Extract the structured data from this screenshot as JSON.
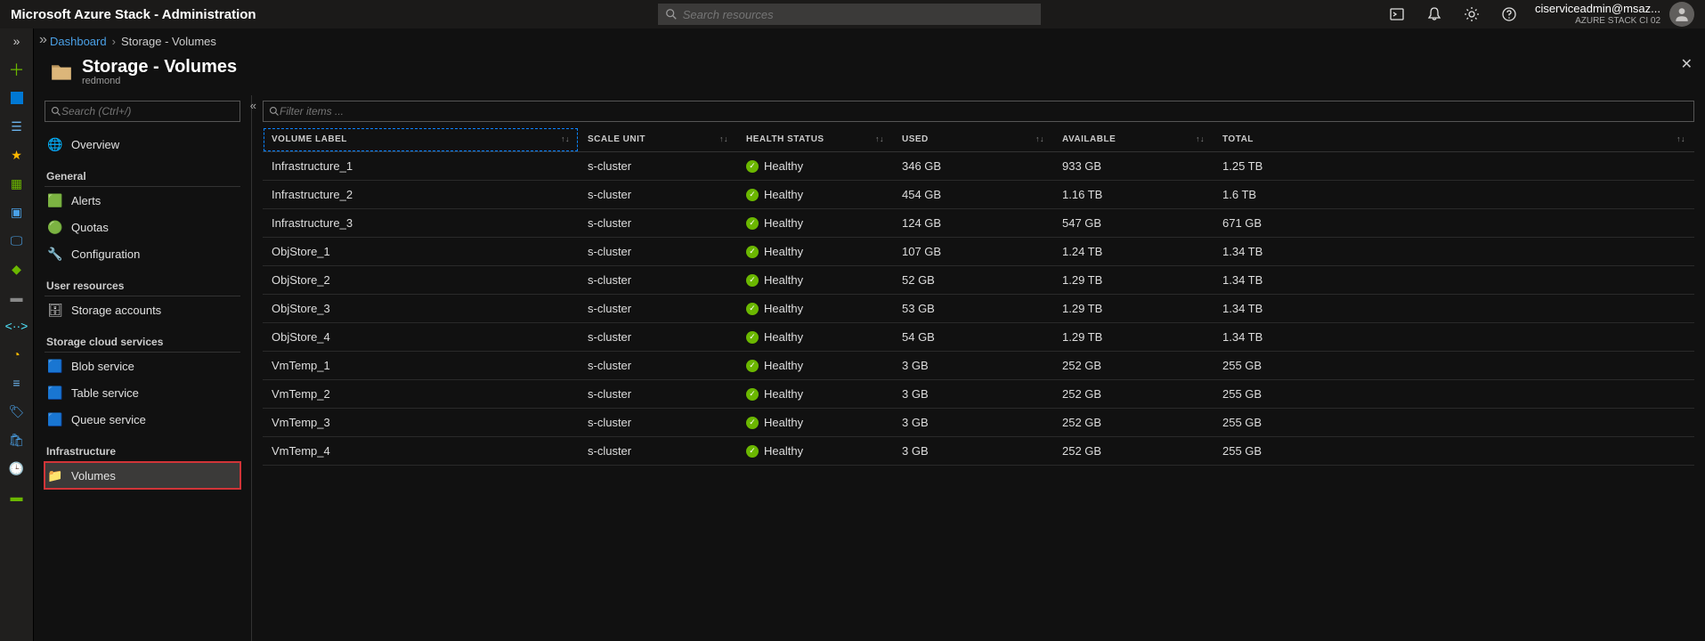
{
  "appTitle": "Microsoft Azure Stack - Administration",
  "topSearchPlaceholder": "Search resources",
  "user": {
    "name": "ciserviceadmin@msaz...",
    "tenant": "AZURE STACK CI 02"
  },
  "breadcrumb": {
    "root": "Dashboard",
    "current": "Storage - Volumes"
  },
  "page": {
    "title": "Storage - Volumes",
    "subtitle": "redmond"
  },
  "sidebarSearchPlaceholder": "Search (Ctrl+/)",
  "filterPlaceholder": "Filter items ...",
  "sidebar": {
    "topItem": {
      "label": "Overview"
    },
    "sections": [
      {
        "title": "General",
        "items": [
          {
            "label": "Alerts"
          },
          {
            "label": "Quotas"
          },
          {
            "label": "Configuration"
          }
        ]
      },
      {
        "title": "User resources",
        "items": [
          {
            "label": "Storage accounts"
          }
        ]
      },
      {
        "title": "Storage cloud services",
        "items": [
          {
            "label": "Blob service"
          },
          {
            "label": "Table service"
          },
          {
            "label": "Queue service"
          }
        ]
      },
      {
        "title": "Infrastructure",
        "items": [
          {
            "label": "Volumes",
            "selected": true
          }
        ]
      }
    ]
  },
  "columns": {
    "label": "VOLUME LABEL",
    "scale": "SCALE UNIT",
    "health": "HEALTH STATUS",
    "used": "USED",
    "avail": "AVAILABLE",
    "total": "TOTAL"
  },
  "rows": [
    {
      "label": "Infrastructure_1",
      "scale": "s-cluster",
      "health": "Healthy",
      "used": "346 GB",
      "avail": "933 GB",
      "total": "1.25 TB"
    },
    {
      "label": "Infrastructure_2",
      "scale": "s-cluster",
      "health": "Healthy",
      "used": "454 GB",
      "avail": "1.16 TB",
      "total": "1.6 TB"
    },
    {
      "label": "Infrastructure_3",
      "scale": "s-cluster",
      "health": "Healthy",
      "used": "124 GB",
      "avail": "547 GB",
      "total": "671 GB"
    },
    {
      "label": "ObjStore_1",
      "scale": "s-cluster",
      "health": "Healthy",
      "used": "107 GB",
      "avail": "1.24 TB",
      "total": "1.34 TB"
    },
    {
      "label": "ObjStore_2",
      "scale": "s-cluster",
      "health": "Healthy",
      "used": "52 GB",
      "avail": "1.29 TB",
      "total": "1.34 TB"
    },
    {
      "label": "ObjStore_3",
      "scale": "s-cluster",
      "health": "Healthy",
      "used": "53 GB",
      "avail": "1.29 TB",
      "total": "1.34 TB"
    },
    {
      "label": "ObjStore_4",
      "scale": "s-cluster",
      "health": "Healthy",
      "used": "54 GB",
      "avail": "1.29 TB",
      "total": "1.34 TB"
    },
    {
      "label": "VmTemp_1",
      "scale": "s-cluster",
      "health": "Healthy",
      "used": "3 GB",
      "avail": "252 GB",
      "total": "255 GB"
    },
    {
      "label": "VmTemp_2",
      "scale": "s-cluster",
      "health": "Healthy",
      "used": "3 GB",
      "avail": "252 GB",
      "total": "255 GB"
    },
    {
      "label": "VmTemp_3",
      "scale": "s-cluster",
      "health": "Healthy",
      "used": "3 GB",
      "avail": "252 GB",
      "total": "255 GB"
    },
    {
      "label": "VmTemp_4",
      "scale": "s-cluster",
      "health": "Healthy",
      "used": "3 GB",
      "avail": "252 GB",
      "total": "255 GB"
    }
  ]
}
